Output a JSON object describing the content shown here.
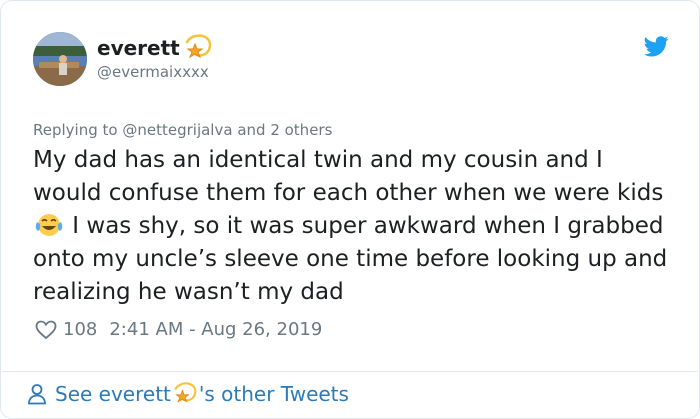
{
  "user": {
    "name": "everett",
    "handle": "@evermaixxxx",
    "avatar_icon": "profile-photo",
    "name_emoji": "dizzy-star"
  },
  "reply": {
    "prefix": "Replying to",
    "target": "@nettegrijalva",
    "suffix": "and 2 others"
  },
  "tweet": {
    "text_before_emoji": "My dad has an identical twin and my cousin and I would confuse them for each other when we were kids",
    "emoji": "face-with-tears-of-joy",
    "text_after_emoji": " I was shy, so it was super awkward when I grabbed onto my uncle’s sleeve one time before looking up and realizing he wasn’t my dad"
  },
  "meta": {
    "likes": "108",
    "timestamp": "2:41 AM - Aug 26, 2019"
  },
  "footer": {
    "see_prefix": "See everett",
    "see_suffix": "'s other Tweets"
  },
  "colors": {
    "link": "#2b7bb9",
    "muted": "#697882",
    "text": "#1c2022",
    "twitter_blue": "#1da1f2",
    "border": "#e1e8ed"
  }
}
